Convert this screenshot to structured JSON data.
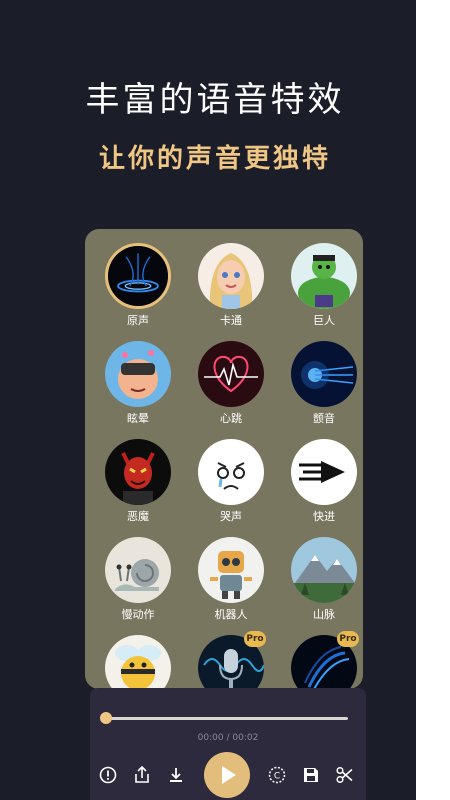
{
  "header": {
    "title": "丰富的语音特效",
    "subtitle": "让你的声音更独特"
  },
  "effects": [
    {
      "label": "原声",
      "icon": "original-sound-icon",
      "selected": true,
      "pro": false
    },
    {
      "label": "卡通",
      "icon": "cartoon-girl-icon",
      "selected": false,
      "pro": false
    },
    {
      "label": "巨人",
      "icon": "giant-hulk-icon",
      "selected": false,
      "pro": false
    },
    {
      "label": "眩晕",
      "icon": "dizzy-face-icon",
      "selected": false,
      "pro": false
    },
    {
      "label": "心跳",
      "icon": "heartbeat-icon",
      "selected": false,
      "pro": false
    },
    {
      "label": "颤音",
      "icon": "vibrato-icon",
      "selected": false,
      "pro": false
    },
    {
      "label": "恶魔",
      "icon": "demon-icon",
      "selected": false,
      "pro": false
    },
    {
      "label": "哭声",
      "icon": "crying-face-icon",
      "selected": false,
      "pro": false
    },
    {
      "label": "快进",
      "icon": "fast-forward-icon",
      "selected": false,
      "pro": false
    },
    {
      "label": "慢动作",
      "icon": "snail-icon",
      "selected": false,
      "pro": false
    },
    {
      "label": "机器人",
      "icon": "robot-icon",
      "selected": false,
      "pro": false
    },
    {
      "label": "山脉",
      "icon": "mountain-icon",
      "selected": false,
      "pro": false
    },
    {
      "label": "",
      "icon": "bee-icon",
      "selected": false,
      "pro": false
    },
    {
      "label": "",
      "icon": "microphone-icon",
      "selected": false,
      "pro": true
    },
    {
      "label": "",
      "icon": "sound-wave-icon",
      "selected": false,
      "pro": true
    }
  ],
  "pro_badge": "Pro",
  "player": {
    "time": "00:00 / 00:02",
    "progress": 0
  },
  "colors": {
    "background": "#1b1d29",
    "panel": "#797660",
    "accent": "#f0c684",
    "player": "#2c2a3c"
  }
}
